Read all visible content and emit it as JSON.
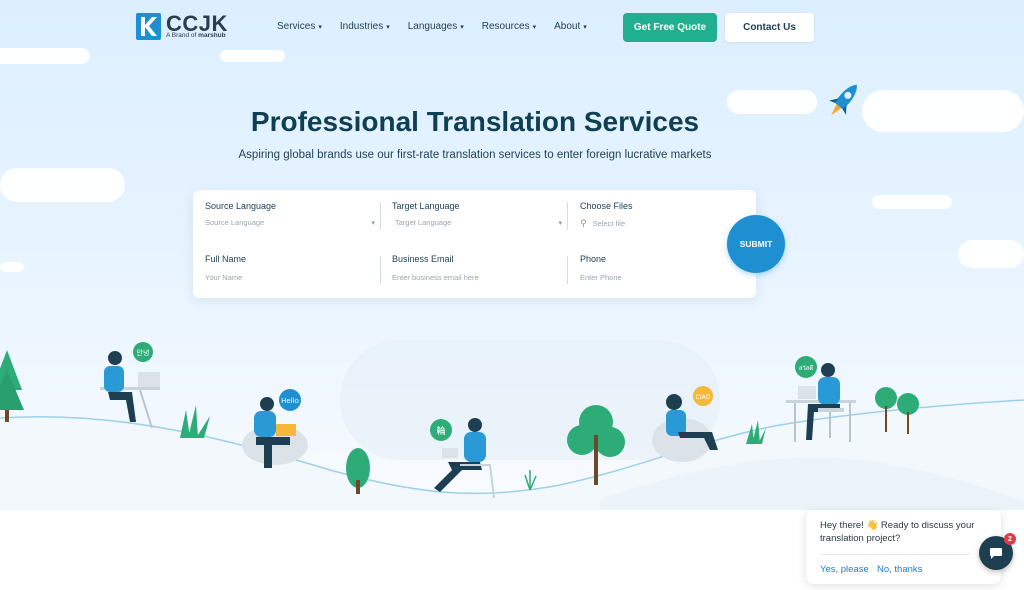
{
  "brand": {
    "name": "CCJK",
    "tagline_prefix": "A Brand of",
    "tagline_brand": "marshub"
  },
  "nav": {
    "items": [
      {
        "label": "Services"
      },
      {
        "label": "Industries"
      },
      {
        "label": "Languages"
      },
      {
        "label": "Resources"
      },
      {
        "label": "About"
      }
    ],
    "caret": "▾",
    "cta_primary": "Get Free Quote",
    "cta_secondary": "Contact Us"
  },
  "hero": {
    "title": "Professional Translation Services",
    "subtitle": "Aspiring global brands use our first-rate translation services to enter foreign lucrative markets"
  },
  "form": {
    "source_language": {
      "label": "Source Language",
      "placeholder": "Source Language"
    },
    "target_language": {
      "label": "Target Language",
      "placeholder": "Target Language"
    },
    "choose_files": {
      "label": "Choose Files",
      "placeholder": "Select file"
    },
    "full_name": {
      "label": "Full Name",
      "placeholder": "Your Name"
    },
    "business_email": {
      "label": "Business Email",
      "placeholder": "Enter business email here"
    },
    "phone": {
      "label": "Phone",
      "placeholder": "Enter Phone"
    },
    "submit_label": "SUBMIT",
    "dropdown_icon": "▾",
    "attach_icon": "⚲"
  },
  "illustration": {
    "bubbles": [
      "안녕",
      "Hello",
      "輪",
      "CIAO",
      "สวัสดี"
    ]
  },
  "chat": {
    "message": "Hey there! 👋 Ready to discuss your translation project?",
    "yes": "Yes, please",
    "no": "No, thanks",
    "badge_count": "2"
  },
  "colors": {
    "primary_green": "#21b08f",
    "primary_blue": "#1e8fd0",
    "heading_navy": "#0f3f52",
    "badge_red": "#e53946"
  }
}
